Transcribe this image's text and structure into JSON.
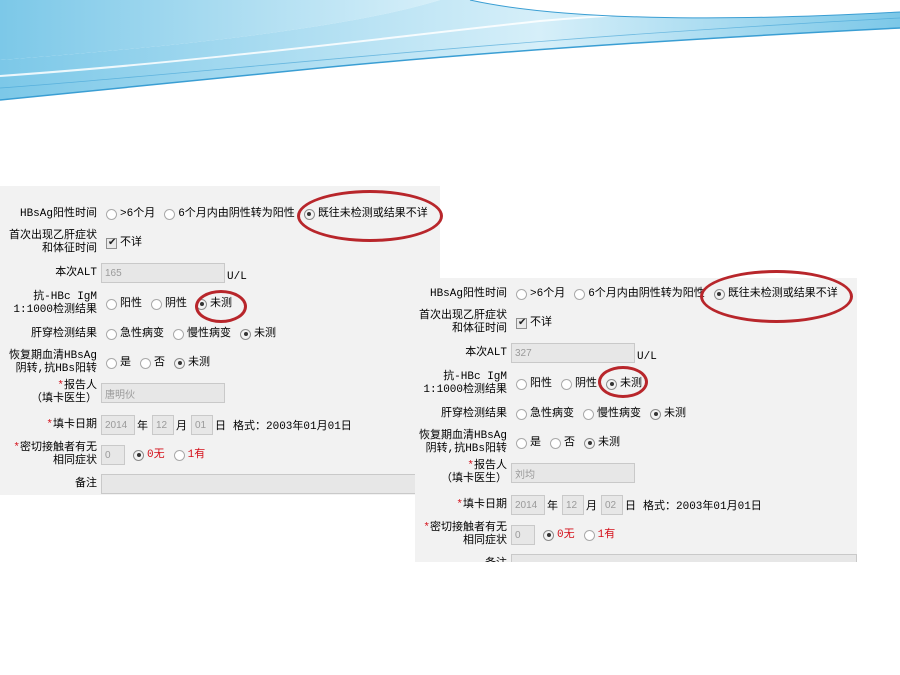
{
  "colors": {
    "accent_red": "#b8262b",
    "option_red": "#d4101a",
    "panel_bg": "#f2f2f2",
    "input_bg": "#e7e7e7",
    "wave_light": "#d6eff9",
    "wave_mid": "#7cc8e8",
    "wave_dark": "#3a9ed3"
  },
  "forms": [
    {
      "hbsag_time": {
        "label": "HBsAg阳性时间",
        "options": [
          ">6个月",
          "6个月内由阴性转为阳性",
          "既往未检测或结果不详"
        ],
        "selected": 2
      },
      "first_symptom": {
        "label_line1": "首次出现乙肝症状",
        "label_line2": "和体征时间",
        "checkbox_label": "不详",
        "checked": true
      },
      "alt": {
        "label": "本次ALT",
        "value": "165",
        "unit": "U/L"
      },
      "anti_hbc": {
        "label_line1": "抗-HBc IgM",
        "label_line2": "1:1000检测结果",
        "options": [
          "阳性",
          "阴性",
          "未测"
        ],
        "selected": 2
      },
      "liver_biopsy": {
        "label": "肝穿检测结果",
        "options": [
          "急性病变",
          "慢性病变",
          "未测"
        ],
        "selected": 2
      },
      "recovery": {
        "label_line1": "恢复期血清HBsAg",
        "label_line2": "阴转,抗HBs阳转",
        "options": [
          "是",
          "否",
          "未测"
        ],
        "selected": 2
      },
      "reporter": {
        "required_mark": "*",
        "label_line1": "报告人",
        "label_line2": "（填卡医生）",
        "value": "唐明伙"
      },
      "fill_date": {
        "required_mark": "*",
        "label": "填卡日期",
        "year": "2014",
        "year_unit": "年",
        "month": "12",
        "month_unit": "月",
        "day": "01",
        "day_unit": "日",
        "format_hint": "格式：2003年01月01日"
      },
      "close_contact": {
        "required_mark": "*",
        "label_line1": "密切接触者有无",
        "label_line2": "相同症状",
        "value": "0",
        "options": [
          "0无",
          "1有"
        ],
        "selected": 0
      },
      "remarks": {
        "label": "备注"
      }
    },
    {
      "hbsag_time": {
        "label": "HBsAg阳性时间",
        "options": [
          ">6个月",
          "6个月内由阴性转为阳性",
          "既往未检测或结果不详"
        ],
        "selected": 2
      },
      "first_symptom": {
        "label_line1": "首次出现乙肝症状",
        "label_line2": "和体征时间",
        "checkbox_label": "不详",
        "checked": true
      },
      "alt": {
        "label": "本次ALT",
        "value": "327",
        "unit": "U/L"
      },
      "anti_hbc": {
        "label_line1": "抗-HBc IgM",
        "label_line2": "1:1000检测结果",
        "options": [
          "阳性",
          "阴性",
          "未测"
        ],
        "selected": 2
      },
      "liver_biopsy": {
        "label": "肝穿检测结果",
        "options": [
          "急性病变",
          "慢性病变",
          "未测"
        ],
        "selected": 2
      },
      "recovery": {
        "label_line1": "恢复期血清HBsAg",
        "label_line2": "阴转,抗HBs阳转",
        "options": [
          "是",
          "否",
          "未测"
        ],
        "selected": 2
      },
      "reporter": {
        "required_mark": "*",
        "label_line1": "报告人",
        "label_line2": "（填卡医生）",
        "value": "刘均"
      },
      "fill_date": {
        "required_mark": "*",
        "label": "填卡日期",
        "year": "2014",
        "year_unit": "年",
        "month": "12",
        "month_unit": "月",
        "day": "02",
        "day_unit": "日",
        "format_hint": "格式：2003年01月01日"
      },
      "close_contact": {
        "required_mark": "*",
        "label_line1": "密切接触者有无",
        "label_line2": "相同症状",
        "value": "0",
        "options": [
          "0无",
          "1有"
        ],
        "selected": 0
      },
      "remarks": {
        "label": "备注"
      }
    }
  ]
}
